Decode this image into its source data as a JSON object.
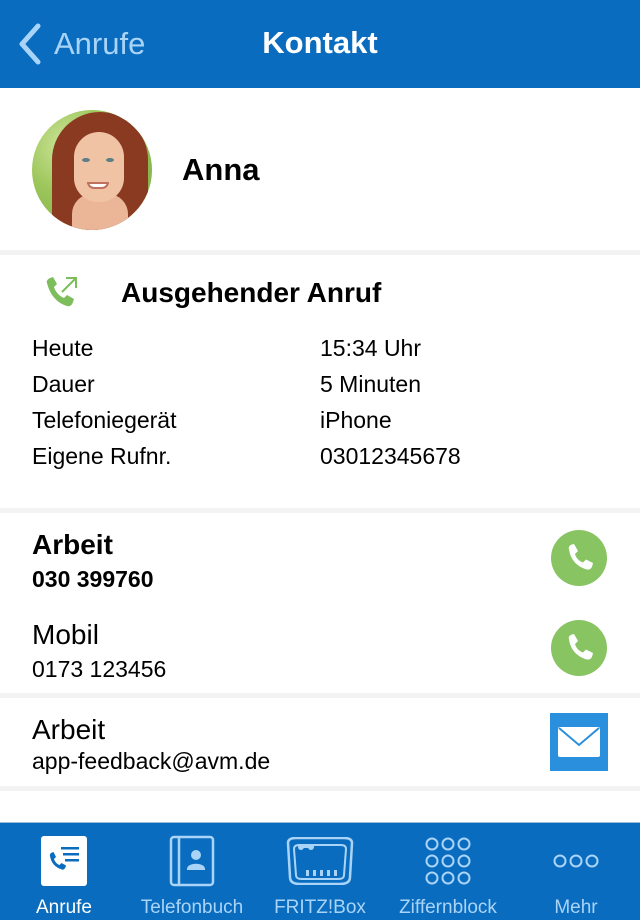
{
  "navbar": {
    "back_label": "Anrufe",
    "title": "Kontakt",
    "back_icon": "chevron-left-icon",
    "colors": {
      "background": "#0a6cbf",
      "back_text": "#a9d4f7",
      "title_text": "#ffffff"
    }
  },
  "contact": {
    "name": "Anna",
    "avatar": "contact-photo"
  },
  "call": {
    "icon": "outgoing-call-icon",
    "title": "Ausgehender Anruf",
    "details": [
      {
        "label": "Heute",
        "value": "15:34 Uhr"
      },
      {
        "label": "Dauer",
        "value": "5 Minuten"
      },
      {
        "label": "Telefoniegerät",
        "value": "iPhone"
      },
      {
        "label": "Eigene Rufnr.",
        "value": "03012345678"
      }
    ]
  },
  "phones": [
    {
      "type": "Arbeit",
      "number": "030 399760",
      "emphasized": true,
      "action_icon": "phone-icon"
    },
    {
      "type": "Mobil",
      "number": "0173 123456",
      "emphasized": false,
      "action_icon": "phone-icon"
    }
  ],
  "emails": [
    {
      "type": "Arbeit",
      "address": "app-feedback@avm.de",
      "action_icon": "mail-icon"
    }
  ],
  "tabbar": {
    "active_index": 0,
    "items": [
      {
        "label": "Anrufe",
        "icon": "calls-list-icon"
      },
      {
        "label": "Telefonbuch",
        "icon": "phonebook-icon"
      },
      {
        "label": "FRITZ!Box",
        "icon": "fritzbox-icon"
      },
      {
        "label": "Ziffernblock",
        "icon": "keypad-icon"
      },
      {
        "label": "Mehr",
        "icon": "more-icon"
      }
    ]
  },
  "colors": {
    "accent_blue": "#0a6cbf",
    "call_green": "#88c462",
    "mail_blue": "#2a8fdc",
    "inactive_tab": "#a9d4f7"
  }
}
